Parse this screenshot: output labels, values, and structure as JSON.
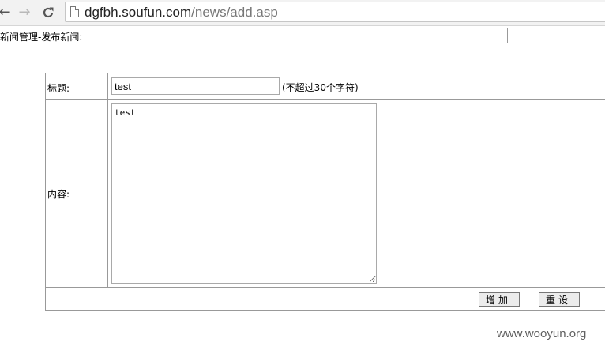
{
  "browser": {
    "url_host": "dgfbh.soufun.com",
    "url_path": "/news/add.asp"
  },
  "page": {
    "header_title": "新闻管理-发布新闻:"
  },
  "form": {
    "title_label": "标题:",
    "title_value": "test",
    "title_hint": "(不超过30个字符)",
    "content_label": "内容:",
    "content_value": "test",
    "add_button": "增加",
    "reset_button": "重设"
  },
  "watermark": "www.wooyun.org"
}
